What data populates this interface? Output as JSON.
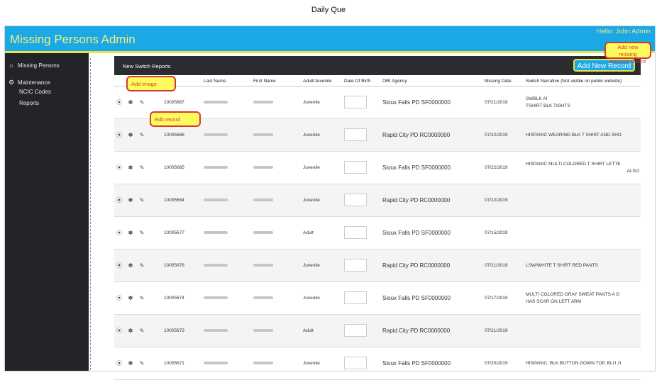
{
  "page_caption": "Daily Que",
  "header": {
    "title": "Missing Persons Admin",
    "greeting": "Hello: John Admin"
  },
  "sidebar": {
    "items": [
      {
        "label": "Missing Persons",
        "icon": "home-icon"
      },
      {
        "label": "Maintenance",
        "icon": "gear-icon"
      }
    ],
    "subitems": [
      {
        "label": "NCIC Codes"
      },
      {
        "label": "Reports"
      }
    ]
  },
  "panel": {
    "title": "New Switch Reports",
    "add_button": "Add New Record"
  },
  "table": {
    "columns": [
      "",
      "",
      "Last Name",
      "First Name",
      "Adult/Juvenile",
      "Date Of Birth",
      "ORI Agency",
      "Missing Date",
      "Switch Narrative (Not visible on public website)"
    ],
    "rows": [
      {
        "id": "10005687",
        "type": "Juvenile",
        "agency": "Sioux Falls PD SF0000000",
        "missing": "07/21/2019",
        "n1": "SWBLK AI",
        "n2": "TSHIRT BLK TIGHTS",
        "n3": ""
      },
      {
        "id": "10005686",
        "type": "Juvenile",
        "agency": "Rapid City PD RC0000000",
        "missing": "07/22/2019",
        "n1": "HISPANIC WEARING BLK T SHIRT AND SHO",
        "n2": "",
        "n3": ""
      },
      {
        "id": "10005685",
        "type": "Juvenile",
        "agency": "Sioux Falls PD SF0000000",
        "missing": "07/22/2019",
        "n1": "HISPANIC MULTI COLORED T SHIRT LETTE",
        "n2": "",
        "n3": "ALSO"
      },
      {
        "id": "10005684",
        "type": "Juvenile",
        "agency": "Rapid City PD RC0000000",
        "missing": "07/22/2019",
        "n1": "",
        "n2": "",
        "n3": ""
      },
      {
        "id": "10005677",
        "type": "Adult",
        "agency": "Sioux Falls PD SF0000000",
        "missing": "07/15/2019",
        "n1": "",
        "n2": "",
        "n3": ""
      },
      {
        "id": "10005676",
        "type": "Juvenile",
        "agency": "Rapid City PD RC0000000",
        "missing": "07/21/2019",
        "n1": "LSW/WHITE T SHIRT RED PANTS",
        "n2": "",
        "n3": ""
      },
      {
        "id": "10005674",
        "type": "Juvenile",
        "agency": "Sioux Falls PD SF0000000",
        "missing": "07/17/2019",
        "n1": "MULTI COLORED GRAY SWEAT PANTS A G",
        "n2": "HAS SCAR ON LEFT ARM",
        "n3": ""
      },
      {
        "id": "10005673",
        "type": "Adult",
        "agency": "Rapid City PD RC0000000",
        "missing": "07/21/2019",
        "n1": "",
        "n2": "",
        "n3": ""
      },
      {
        "id": "10005671",
        "type": "Juvenile",
        "agency": "Sioux Falls PD SF0000000",
        "missing": "07/20/2019",
        "n1": "HISPANIC; BLK BUTTON DOWN TOP, BLU JI",
        "n2": "",
        "n3": ""
      }
    ]
  },
  "callouts": {
    "add_image": "Add image",
    "edit_record": "Edit record",
    "add_new_missing": "Add new missing persons record"
  },
  "colors": {
    "topbar": "#1aa9e6",
    "title": "#f7f07a",
    "sidebar": "#222428",
    "callout_bg": "#fffb5c",
    "callout_border": "#d43a2e"
  }
}
